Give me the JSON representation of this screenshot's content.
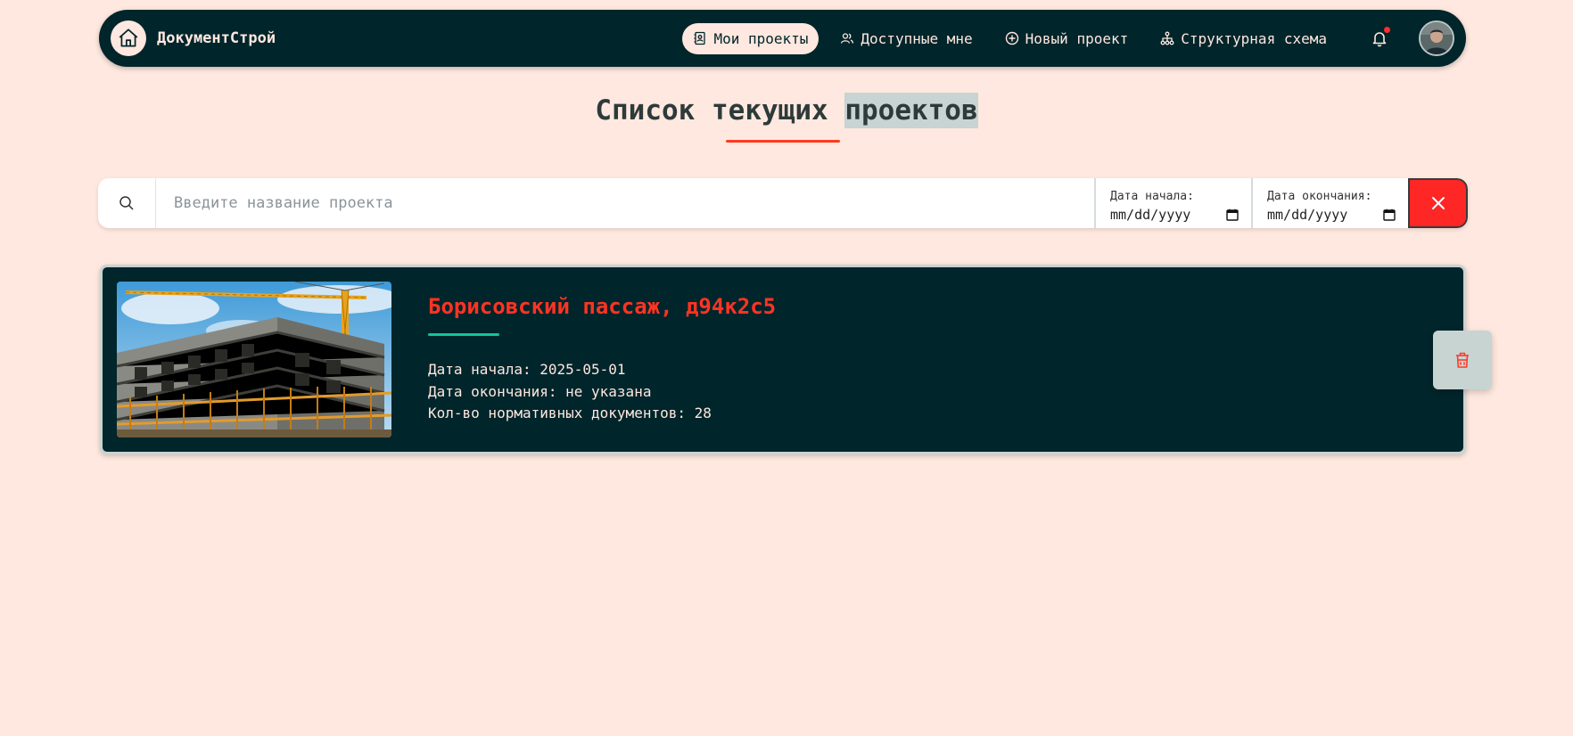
{
  "brand": {
    "name": "ДокументСтрой",
    "logo_icon": "home-icon"
  },
  "nav": {
    "items": [
      {
        "label": "Мои проекты",
        "icon": "contacts-book-icon",
        "active": true
      },
      {
        "label": "Доступные мне",
        "icon": "users-icon",
        "active": false
      },
      {
        "label": "Новый проект",
        "icon": "plus-circle-icon",
        "active": false
      },
      {
        "label": "Структурная схема",
        "icon": "sitemap-icon",
        "active": false
      }
    ],
    "notifications_icon": "bell-icon",
    "has_unread": true
  },
  "page": {
    "title_part1": "Список текущих",
    "title_part2": "проектов"
  },
  "filters": {
    "search_placeholder": "Введите название проекта",
    "start_date_label": "Дата начала:",
    "start_date_value": "mm/dd/yyyy",
    "end_date_label": "Дата окончания:",
    "end_date_value": "mm/dd/yyyy",
    "clear_icon": "close-icon"
  },
  "projects": [
    {
      "title": "Борисовский пассаж, д94к2с5",
      "start_date": "Дата начала: 2025-05-01",
      "end_date": "Дата окончания: не указана",
      "docs_count": "Кол-во нормативных документов: 28",
      "image": "construction-site-photo"
    }
  ],
  "colors": {
    "background": "#fee8df",
    "navbar": "#00252b",
    "accent_red": "#ff2626",
    "accent_teal": "#12c49a",
    "highlight": "#c7d4d2"
  }
}
